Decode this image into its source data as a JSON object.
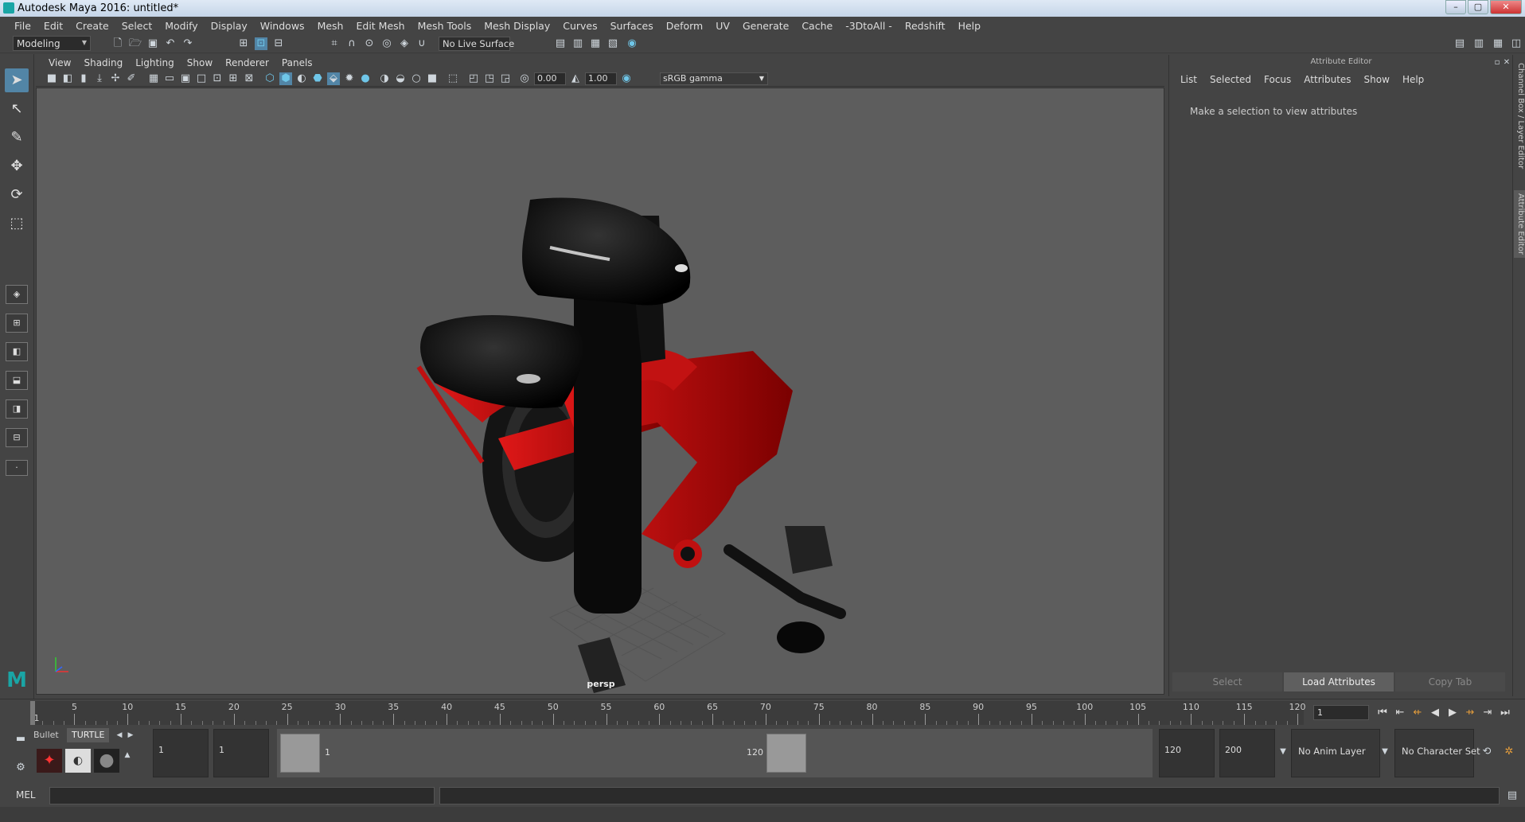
{
  "window": {
    "title": "Autodesk Maya 2016: untitled*",
    "min": "–",
    "max": "▢",
    "close": "✕"
  },
  "menubar": [
    "File",
    "Edit",
    "Create",
    "Select",
    "Modify",
    "Display",
    "Windows",
    "Mesh",
    "Edit Mesh",
    "Mesh Tools",
    "Mesh Display",
    "Curves",
    "Surfaces",
    "Deform",
    "UV",
    "Generate",
    "Cache",
    "-3DtoAll -",
    "Redshift",
    "Help"
  ],
  "statusline": {
    "mode": "Modeling",
    "live_surface": "No Live Surface"
  },
  "viewport_menu": [
    "View",
    "Shading",
    "Lighting",
    "Show",
    "Renderer",
    "Panels"
  ],
  "viewport_toolbar": {
    "exposure": "0.00",
    "gamma": "1.00",
    "color_space": "sRGB gamma"
  },
  "viewport": {
    "camera_label": "persp"
  },
  "attribute_editor": {
    "title": "Attribute Editor",
    "menu": [
      "List",
      "Selected",
      "Focus",
      "Attributes",
      "Show",
      "Help"
    ],
    "message": "Make a selection to view attributes",
    "buttons": [
      "Select",
      "Load Attributes",
      "Copy Tab"
    ]
  },
  "side_tabs": [
    "Channel Box / Layer Editor",
    "Attribute Editor"
  ],
  "timeline": {
    "labels": [
      "1",
      "5",
      "10",
      "15",
      "20",
      "25",
      "30",
      "35",
      "40",
      "45",
      "50",
      "55",
      "60",
      "65",
      "70",
      "75",
      "80",
      "85",
      "90",
      "95",
      "100",
      "105",
      "110",
      "115",
      "120"
    ],
    "current_frame": "1"
  },
  "shelf": {
    "tabs": [
      "Bullet",
      "TURTLE"
    ]
  },
  "range": {
    "start": "1",
    "playback_start": "1",
    "handle_start": "1",
    "handle_end": "120",
    "playback_end": "120",
    "end": "200",
    "anim_layer": "No Anim Layer",
    "character_set": "No Character Set"
  },
  "command": {
    "label": "MEL"
  }
}
